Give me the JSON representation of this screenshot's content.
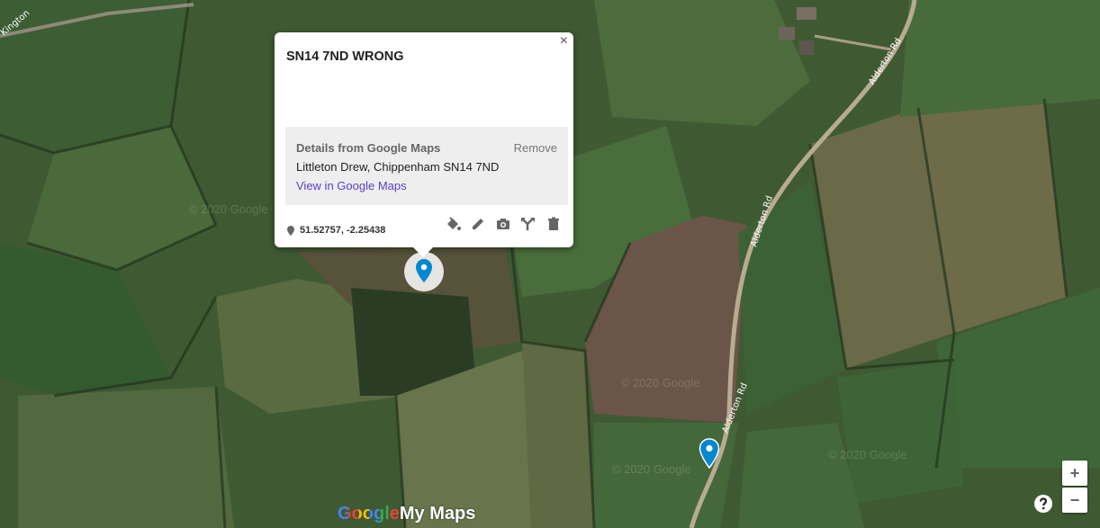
{
  "map": {
    "roads": [
      "Alderton Rd",
      "Alderton Rd",
      "Alderton Rd",
      "Kington"
    ],
    "watermark": "© 2020 Google"
  },
  "popup": {
    "title": "SN14 7ND WRONG",
    "close_label": "×",
    "details_heading": "Details from Google Maps",
    "remove_label": "Remove",
    "address": "Littleton Drew, Chippenham SN14 7ND",
    "link_label": "View in Google Maps",
    "coordinates": "51.52757, -2.25438",
    "tools": [
      "paint-bucket-icon",
      "pencil-icon",
      "camera-icon",
      "directions-icon",
      "trash-icon"
    ]
  },
  "branding": {
    "logo_google": "Google",
    "logo_mymaps": "My Maps"
  },
  "controls": {
    "zoom_in": "+",
    "zoom_out": "−"
  },
  "colors": {
    "marker": "#0288d1",
    "link": "#5b3ec8"
  }
}
